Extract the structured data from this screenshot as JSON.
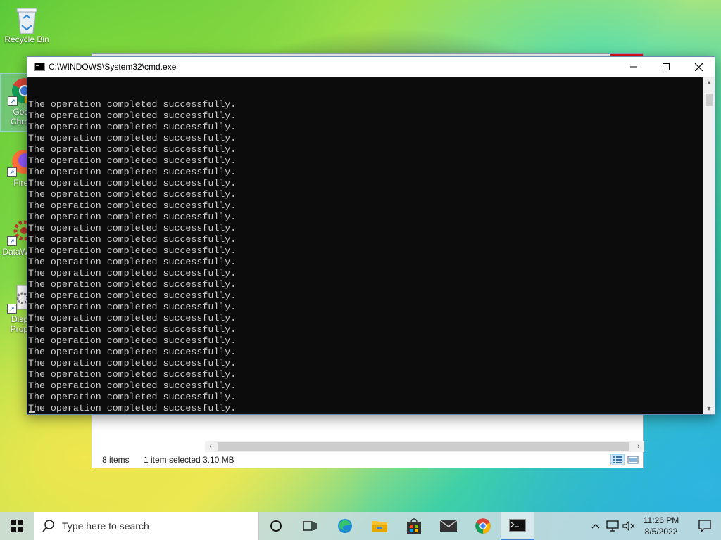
{
  "desktop": {
    "icons": [
      {
        "label": "Recycle Bin"
      },
      {
        "label": "Google Chrome",
        "label_visible": "Goo\nChro"
      },
      {
        "label_visible": "Fire"
      },
      {
        "label_visible": "DataW"
      },
      {
        "label_visible": "Disp\nProp"
      }
    ]
  },
  "explorer": {
    "status": {
      "items": "8 items",
      "selected": "1 item selected",
      "size": "3.10 MB"
    }
  },
  "cmd": {
    "title": "C:\\WINDOWS\\System32\\cmd.exe",
    "lines": [
      "The operation completed successfully.",
      "The operation completed successfully.",
      "The operation completed successfully.",
      "The operation completed successfully.",
      "The operation completed successfully.",
      "The operation completed successfully.",
      "The operation completed successfully.",
      "The operation completed successfully.",
      "The operation completed successfully.",
      "The operation completed successfully.",
      "The operation completed successfully.",
      "The operation completed successfully.",
      "The operation completed successfully.",
      "The operation completed successfully.",
      "The operation completed successfully.",
      "The operation completed successfully.",
      "The operation completed successfully.",
      "The operation completed successfully.",
      "The operation completed successfully.",
      "The operation completed successfully.",
      "The operation completed successfully.",
      "The operation completed successfully.",
      "The operation completed successfully.",
      "The operation completed successfully.",
      "The operation completed successfully.",
      "The operation completed successfully.",
      "The operation completed successfully.",
      "The operation completed successfully.",
      "The operation completed successfully."
    ]
  },
  "taskbar": {
    "search_placeholder": "Type here to search",
    "apps": [
      "task-view",
      "edge",
      "file-explorer",
      "store",
      "mail",
      "chrome",
      "cmd"
    ],
    "clock": {
      "time": "11:26 PM",
      "date": "8/5/2022"
    }
  },
  "colors": {
    "console_bg": "#0c0c0c",
    "console_fg": "#cccccc",
    "close_red": "#e81123",
    "taskbar_accent": "#3d7fd1"
  }
}
